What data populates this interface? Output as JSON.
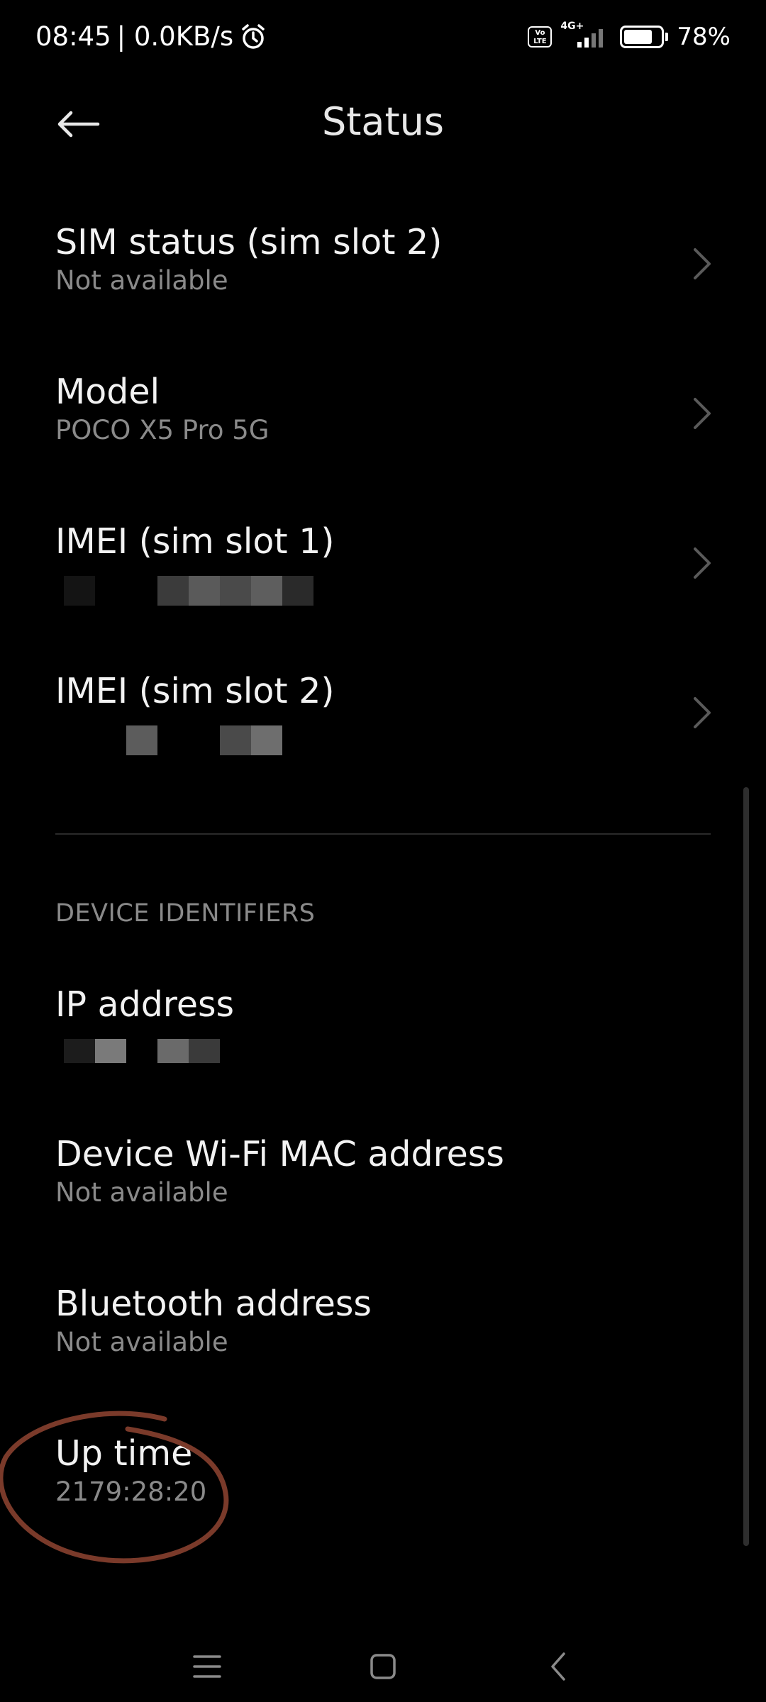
{
  "status_bar": {
    "time": "08:45",
    "network_speed": "| 0.0KB/s",
    "volte_label": "Vo LTE",
    "network_type": "4G+",
    "battery_percent": "78%",
    "battery_level": 0.78,
    "icons": [
      "alarm-icon",
      "volte-icon",
      "signal-icon",
      "battery-icon"
    ]
  },
  "header": {
    "title": "Status",
    "back_icon": "arrow-left-icon"
  },
  "items": [
    {
      "label": "SIM status (sim slot 2)",
      "value": "Not available"
    },
    {
      "label": "Model",
      "value": "POCO X5 Pro 5G"
    },
    {
      "label": "IMEI (sim slot 1)",
      "value": ""
    },
    {
      "label": "IMEI (sim slot 2)",
      "value": ""
    }
  ],
  "section_title": "DEVICE IDENTIFIERS",
  "identifiers": [
    {
      "label": "IP address",
      "value": ""
    },
    {
      "label": "Device Wi-Fi MAC address",
      "value": "Not available"
    },
    {
      "label": "Bluetooth address",
      "value": "Not available"
    },
    {
      "label": "Up time",
      "value": "2179:28:20"
    }
  ],
  "navbar": {
    "icons": [
      "menu-icon",
      "home-icon",
      "back-icon"
    ]
  },
  "colors": {
    "background": "#000000",
    "label": "#f2f2f2",
    "secondary": "#8a8a8a",
    "annotation": "#7a3a2a"
  }
}
